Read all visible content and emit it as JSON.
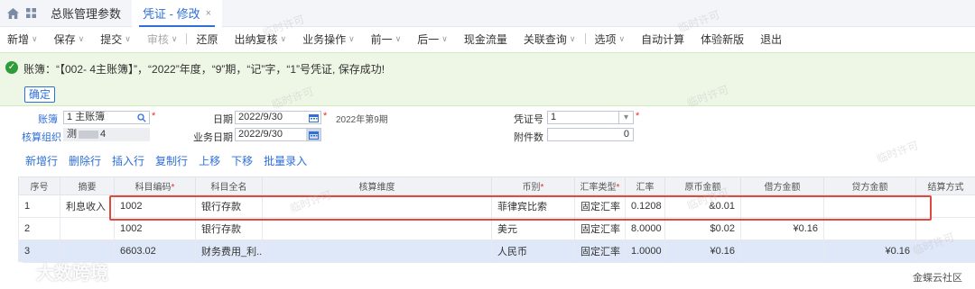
{
  "tabbar": {
    "tabs": [
      {
        "label": "总账管理参数"
      },
      {
        "label": "凭证 - 修改"
      }
    ],
    "close": "×"
  },
  "toolbar": {
    "items": [
      {
        "label": "新增",
        "caret": true
      },
      {
        "label": "保存",
        "caret": true
      },
      {
        "label": "提交",
        "caret": true
      },
      {
        "label": "审核",
        "caret": true,
        "disabled": true
      },
      {
        "label": "还原"
      },
      {
        "label": "出纳复核",
        "caret": true
      },
      {
        "label": "业务操作",
        "caret": true
      },
      {
        "label": "前一",
        "caret": true
      },
      {
        "label": "后一",
        "caret": true
      },
      {
        "label": "现金流量"
      },
      {
        "label": "关联查询",
        "caret": true
      },
      {
        "label": "选项",
        "caret": true
      },
      {
        "label": "自动计算"
      },
      {
        "label": "体验新版"
      },
      {
        "label": "退出"
      }
    ]
  },
  "message": {
    "text": "账簿：“【002-  4主账簿】”，“2022”年度，“9”期，“记”字，“1”号凭证, 保存成功!",
    "confirm": "确定"
  },
  "form": {
    "book_label": "账簿",
    "book_value": "1  主账簿",
    "org_label": "核算组织",
    "org_value": "测",
    "org_suffix": "4",
    "date_label": "日期",
    "date_value": "2022/9/30",
    "period_text": "2022年第9期",
    "bizdate_label": "业务日期",
    "bizdate_value": "2022/9/30",
    "voucher_label": "凭证号",
    "voucher_value": "1",
    "attach_label": "附件数",
    "attach_value": "0"
  },
  "actions": [
    "新增行",
    "删除行",
    "插入行",
    "复制行",
    "上移",
    "下移",
    "批量录入"
  ],
  "table": {
    "headers": [
      "序号",
      "摘要",
      "科目编码",
      "科目全名",
      "核算维度",
      "币别",
      "汇率类型",
      "汇率",
      "原币金额",
      "借方金额",
      "贷方金额",
      "结算方式"
    ],
    "required": [
      false,
      false,
      true,
      false,
      false,
      true,
      true,
      false,
      false,
      false,
      false,
      false
    ],
    "rows": [
      [
        "1",
        "利息收入",
        "1002",
        "银行存款",
        "",
        "菲律宾比索",
        "固定汇率",
        "0.1208",
        "&0.01",
        "",
        "",
        ""
      ],
      [
        "2",
        "",
        "1002",
        "银行存款",
        "",
        "美元",
        "固定汇率",
        "8.0000",
        "$0.02",
        "¥0.16",
        "",
        ""
      ],
      [
        "3",
        "",
        "6603.02",
        "财务费用_利...",
        "",
        "人民币",
        "固定汇率",
        "1.0000",
        "¥0.16",
        "",
        "¥0.16",
        ""
      ]
    ]
  },
  "watermark": "临时许可",
  "brand": "大数跨境",
  "community": "金蝶云社区"
}
